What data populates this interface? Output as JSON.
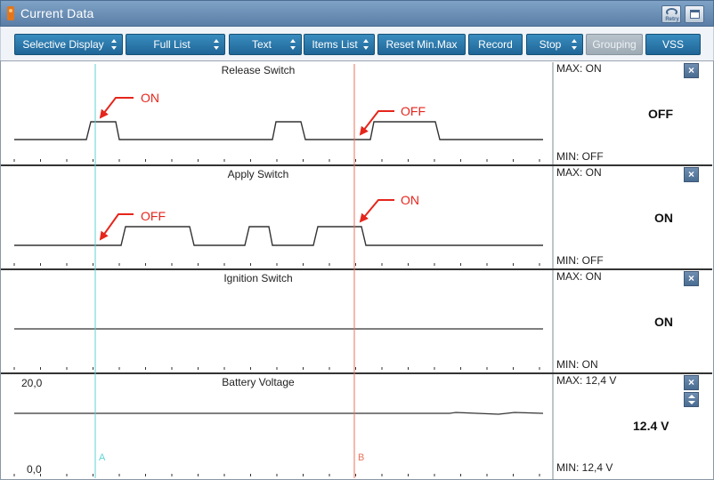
{
  "window": {
    "title": "Current Data",
    "retry_label": "Retry"
  },
  "toolbar": {
    "buttons": [
      {
        "label": "Selective Display",
        "spinner": true,
        "enabled": true
      },
      {
        "label": "Full List",
        "spinner": true,
        "enabled": true
      },
      {
        "label": "Text",
        "spinner": true,
        "enabled": true
      },
      {
        "label": "Items List",
        "spinner": true,
        "enabled": true
      },
      {
        "label": "Reset Min.Max",
        "spinner": false,
        "enabled": true
      },
      {
        "label": "Record",
        "spinner": false,
        "enabled": true
      },
      {
        "label": "Stop",
        "spinner": true,
        "enabled": true
      },
      {
        "label": "Grouping",
        "spinner": false,
        "enabled": false
      },
      {
        "label": "VSS",
        "spinner": false,
        "enabled": true
      }
    ]
  },
  "graphs": [
    {
      "title": "Release Switch",
      "max_label": "MAX: ON",
      "min_label": "MIN: OFF",
      "value": "OFF",
      "annotations": [
        {
          "label": "ON",
          "target": "cursor-a"
        },
        {
          "label": "OFF",
          "target": "cursor-b"
        }
      ]
    },
    {
      "title": "Apply Switch",
      "max_label": "MAX: ON",
      "min_label": "MIN: OFF",
      "value": "ON",
      "annotations": [
        {
          "label": "OFF",
          "target": "cursor-a"
        },
        {
          "label": "ON",
          "target": "cursor-b"
        }
      ]
    },
    {
      "title": "Ignition Switch",
      "max_label": "MAX: ON",
      "min_label": "MIN: ON",
      "value": "ON"
    },
    {
      "title": "Battery Voltage",
      "max_label": "MAX:  12,4 V",
      "min_label": "MIN:  12,4 V",
      "value": "12.4 V",
      "y_top_label": "20,0",
      "y_bottom_label": "0,0"
    }
  ],
  "cursors": {
    "a": {
      "label": "A",
      "color": "#5fd3d3"
    },
    "b": {
      "label": "B",
      "color": "#e8735a"
    }
  },
  "colors": {
    "accent": "#2b79ad",
    "annotation": "#e5261c",
    "title_bar": "#6d91b8"
  },
  "close_symbol": "×"
}
